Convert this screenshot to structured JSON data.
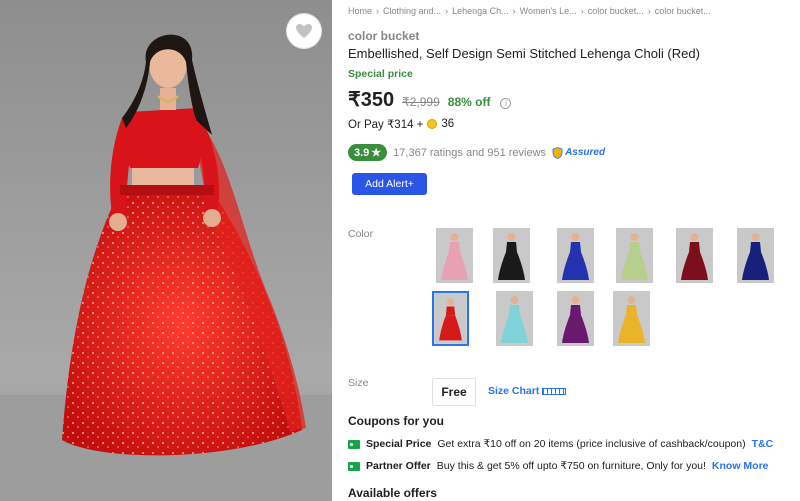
{
  "breadcrumbs": [
    "Home",
    "Clothing and...",
    "Lehenga Ch...",
    "Women's Le...",
    "color bucket...",
    "color bucket..."
  ],
  "product": {
    "brand": "color bucket",
    "title": "Embellished, Self Design Semi Stitched Lehenga Choli  (Red)",
    "special_label": "Special price",
    "price": "₹350",
    "mrp": "₹2,999",
    "discount": "88% off",
    "info_icon": "i",
    "or_pay_text": "Or Pay ₹314 +",
    "coins": "36",
    "rating": "3.9",
    "rating_star": "★",
    "ratings_reviews": "17,367 ratings and 951 reviews",
    "assured_label": "Assured",
    "alert_button": "Add Alert+"
  },
  "variants": {
    "label": "Color",
    "swatches": [
      {
        "name": "pink",
        "color": "#e8a1b3"
      },
      {
        "name": "black",
        "color": "#1a1a1a"
      },
      {
        "name": "royal-blue",
        "color": "#2333b0"
      },
      {
        "name": "pista-green",
        "color": "#b7cf8c"
      },
      {
        "name": "maroon",
        "color": "#7d0f1c"
      },
      {
        "name": "navy",
        "color": "#17207a"
      },
      {
        "name": "red",
        "color": "#d61a1a",
        "selected": true
      },
      {
        "name": "sky-blue",
        "color": "#7fd3d6"
      },
      {
        "name": "purple",
        "color": "#6a1a6e"
      },
      {
        "name": "mustard",
        "color": "#e9b42a"
      }
    ]
  },
  "size": {
    "label": "Size",
    "value": "Free",
    "chart_label": "Size Chart"
  },
  "coupons": {
    "heading": "Coupons for you",
    "offers": [
      {
        "title": "Special Price",
        "text": "Get extra ₹10 off on 20 items (price inclusive of cashback/coupon)",
        "link": "T&C"
      },
      {
        "title": "Partner Offer",
        "text": "Buy this & get 5% off upto ₹750 on furniture, Only for you!",
        "link": "Know More"
      }
    ]
  },
  "available_offers_heading": "Available offers",
  "colors": {
    "accent": "#2874f0",
    "green": "#388e3c",
    "button": "#2a55e5",
    "dress_red": "#d61a1a"
  }
}
